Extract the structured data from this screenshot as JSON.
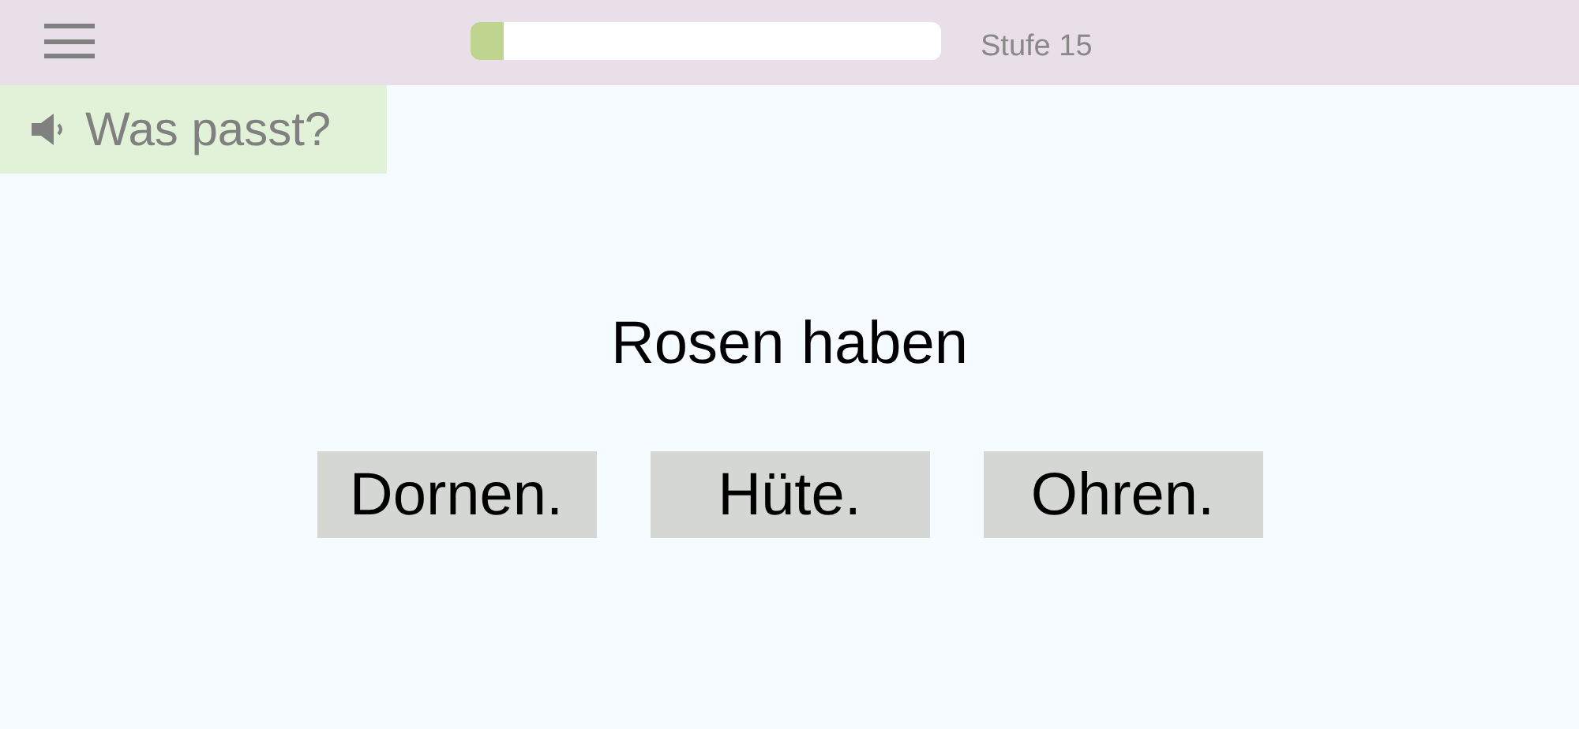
{
  "header": {
    "progress": {
      "level": 0.07
    },
    "level_label": "Stufe 15"
  },
  "prompt": {
    "label": "Was passt?"
  },
  "question": "Rosen haben",
  "answers": [
    {
      "label": "Dornen."
    },
    {
      "label": "Hüte."
    },
    {
      "label": "Ohren."
    }
  ]
}
